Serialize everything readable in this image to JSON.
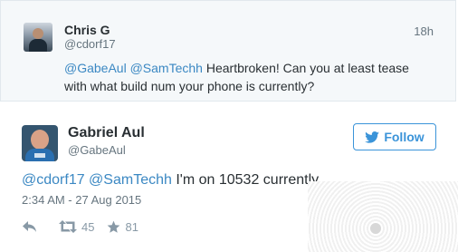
{
  "reply_tweet": {
    "name": "Chris G",
    "handle": "@cdorf17",
    "time": "18h",
    "mentions": "@GabeAul @SamTechh",
    "text": " Heartbroken! Can you at least tease with what build num your phone is currently?"
  },
  "main_tweet": {
    "name": "Gabriel Aul",
    "handle": "@GabeAul",
    "follow_label": "Follow",
    "mentions": "@cdorf17 @SamTechh",
    "text": " I'm on 10532 currently",
    "timestamp": "2:34 AM - 27 Aug 2015",
    "retweet_count": "45",
    "favorite_count": "81"
  },
  "icons": {
    "reply": "reply-arrow-icon",
    "retweet": "retweet-icon",
    "favorite": "star-icon",
    "follow": "twitter-bird-icon"
  },
  "colors": {
    "link": "#3b88c3",
    "follow_border": "#3b94d9",
    "muted": "#66757f",
    "reply_background": "#f5f8fa"
  }
}
